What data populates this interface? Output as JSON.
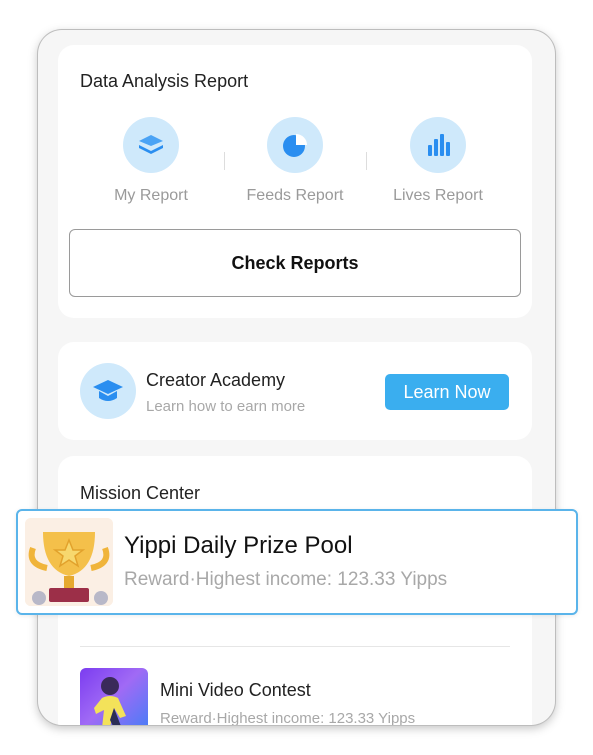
{
  "report": {
    "title": "Data Analysis Report",
    "items": [
      {
        "label": "My Report",
        "icon": "layers-icon"
      },
      {
        "label": "Feeds Report",
        "icon": "pie-chart-icon"
      },
      {
        "label": "Lives Report",
        "icon": "bar-chart-icon"
      }
    ],
    "button_label": "Check Reports"
  },
  "academy": {
    "title": "Creator Academy",
    "subtitle": "Learn how to earn more",
    "button_label": "Learn Now",
    "icon": "graduation-cap-icon"
  },
  "mission": {
    "title": "Mission Center",
    "items": [
      {
        "title": "Yippi Daily Prize Pool",
        "subtitle": "Reward·Highest income: 123.33 Yipps",
        "thumb": "trophy-icon"
      },
      {
        "title": "Mini Video Contest",
        "subtitle": "Reward·Highest income: 123.33 Yipps",
        "thumb": "dancer-image"
      }
    ]
  },
  "colors": {
    "accent": "#3aaeef",
    "icon_bg": "#cfe9fb",
    "icon_fg": "#2a8ef0",
    "highlight_border": "#5ab4ea"
  }
}
